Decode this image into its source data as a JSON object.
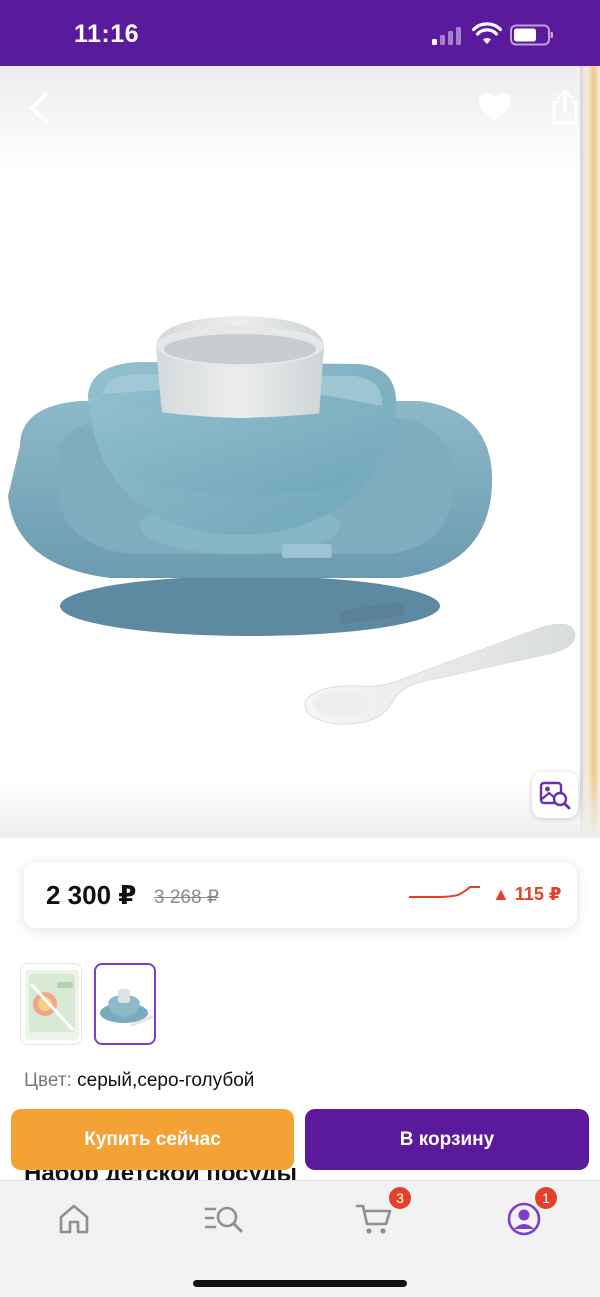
{
  "status_bar": {
    "time": "11:16"
  },
  "gallery": {
    "back_icon": "chevron-left-icon",
    "favorite_icon": "heart-icon",
    "share_icon": "share-icon",
    "visual_search_icon": "image-search-icon"
  },
  "price": {
    "current": "2 300 ₽",
    "old": "3 268 ₽",
    "change": "▲ 115 ₽",
    "change_color": "#e5402a"
  },
  "color": {
    "label": "Цвет:",
    "value": "серый,серо-голубой"
  },
  "title_peek": "Набор детской посуды",
  "actions": {
    "buy_now": "Купить сейчас",
    "add_to_cart": "В корзину"
  },
  "tab_bar": {
    "items": [
      {
        "icon": "home-icon"
      },
      {
        "icon": "catalog-search-icon"
      },
      {
        "icon": "cart-icon",
        "badge": "3"
      },
      {
        "icon": "profile-icon",
        "badge": "1"
      }
    ]
  },
  "colors": {
    "brand": "#5b1a9c",
    "accent": "#f4a235",
    "alert": "#e5402a"
  }
}
